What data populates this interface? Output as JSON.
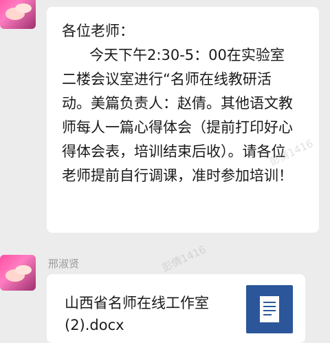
{
  "messages": [
    {
      "sender": "",
      "text": "各位老师：\n      今天下午2:30-5：00在实验室二楼会议室进行“名师在线教研活动。美篇负责人：赵倩。其他语文教师每人一篇心得体会（提前打印好心得体会表，培训结束后收）。请各位老师提前自行调课，准时参加培训！"
    },
    {
      "sender": "邢淑贤",
      "file": {
        "name": "山西省名师在线工作室(2).docx",
        "icon": "word-doc-icon"
      }
    }
  ],
  "watermark": "彭倩1416",
  "colors": {
    "background": "#ececec",
    "bubble": "#ffffff",
    "doc_icon": "#2b579a"
  }
}
